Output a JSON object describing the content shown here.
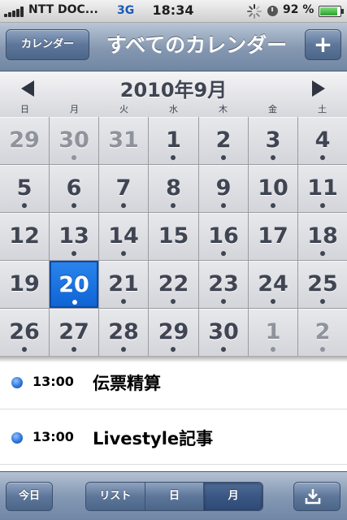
{
  "status_bar": {
    "carrier": "NTT DOC...",
    "network": "3G",
    "time": "18:34",
    "battery_percent": "92 %",
    "battery_level": 0.92,
    "icons": [
      "signal-icon",
      "activity-spinner-icon",
      "rotation-lock-icon",
      "battery-icon"
    ]
  },
  "nav_bar": {
    "back_label": "カレンダー",
    "title": "すべてのカレンダー",
    "add_label": "+"
  },
  "calendar": {
    "month_title": "2010年9月",
    "prev_icon": "left-arrow-icon",
    "next_icon": "right-arrow-icon",
    "weekdays": [
      "日",
      "月",
      "火",
      "水",
      "木",
      "金",
      "土"
    ],
    "selected_day": "20",
    "weeks": [
      [
        {
          "d": "29",
          "other": true,
          "dot": false
        },
        {
          "d": "30",
          "other": true,
          "dot": true
        },
        {
          "d": "31",
          "other": true,
          "dot": false
        },
        {
          "d": "1",
          "other": false,
          "dot": true
        },
        {
          "d": "2",
          "other": false,
          "dot": true
        },
        {
          "d": "3",
          "other": false,
          "dot": true
        },
        {
          "d": "4",
          "other": false,
          "dot": true
        }
      ],
      [
        {
          "d": "5",
          "other": false,
          "dot": true
        },
        {
          "d": "6",
          "other": false,
          "dot": true
        },
        {
          "d": "7",
          "other": false,
          "dot": true
        },
        {
          "d": "8",
          "other": false,
          "dot": true
        },
        {
          "d": "9",
          "other": false,
          "dot": true
        },
        {
          "d": "10",
          "other": false,
          "dot": true
        },
        {
          "d": "11",
          "other": false,
          "dot": true
        }
      ],
      [
        {
          "d": "12",
          "other": false,
          "dot": false
        },
        {
          "d": "13",
          "other": false,
          "dot": true
        },
        {
          "d": "14",
          "other": false,
          "dot": true
        },
        {
          "d": "15",
          "other": false,
          "dot": false
        },
        {
          "d": "16",
          "other": false,
          "dot": true
        },
        {
          "d": "17",
          "other": false,
          "dot": false
        },
        {
          "d": "18",
          "other": false,
          "dot": true
        }
      ],
      [
        {
          "d": "19",
          "other": false,
          "dot": false
        },
        {
          "d": "20",
          "other": false,
          "dot": true
        },
        {
          "d": "21",
          "other": false,
          "dot": true
        },
        {
          "d": "22",
          "other": false,
          "dot": true
        },
        {
          "d": "23",
          "other": false,
          "dot": true
        },
        {
          "d": "24",
          "other": false,
          "dot": true
        },
        {
          "d": "25",
          "other": false,
          "dot": true
        }
      ],
      [
        {
          "d": "26",
          "other": false,
          "dot": true
        },
        {
          "d": "27",
          "other": false,
          "dot": true
        },
        {
          "d": "28",
          "other": false,
          "dot": true
        },
        {
          "d": "29",
          "other": false,
          "dot": true
        },
        {
          "d": "30",
          "other": false,
          "dot": true
        },
        {
          "d": "1",
          "other": true,
          "dot": true
        },
        {
          "d": "2",
          "other": true,
          "dot": true
        }
      ]
    ]
  },
  "events": [
    {
      "time": "13:00",
      "title": "伝票精算",
      "color": "#2a6fd6"
    },
    {
      "time": "13:00",
      "title": "Livestyle記事",
      "color": "#2a6fd6"
    }
  ],
  "toolbar": {
    "today_label": "今日",
    "segments": [
      "リスト",
      "日",
      "月"
    ],
    "active_segment": "月",
    "download_icon": "download-tray-icon"
  }
}
